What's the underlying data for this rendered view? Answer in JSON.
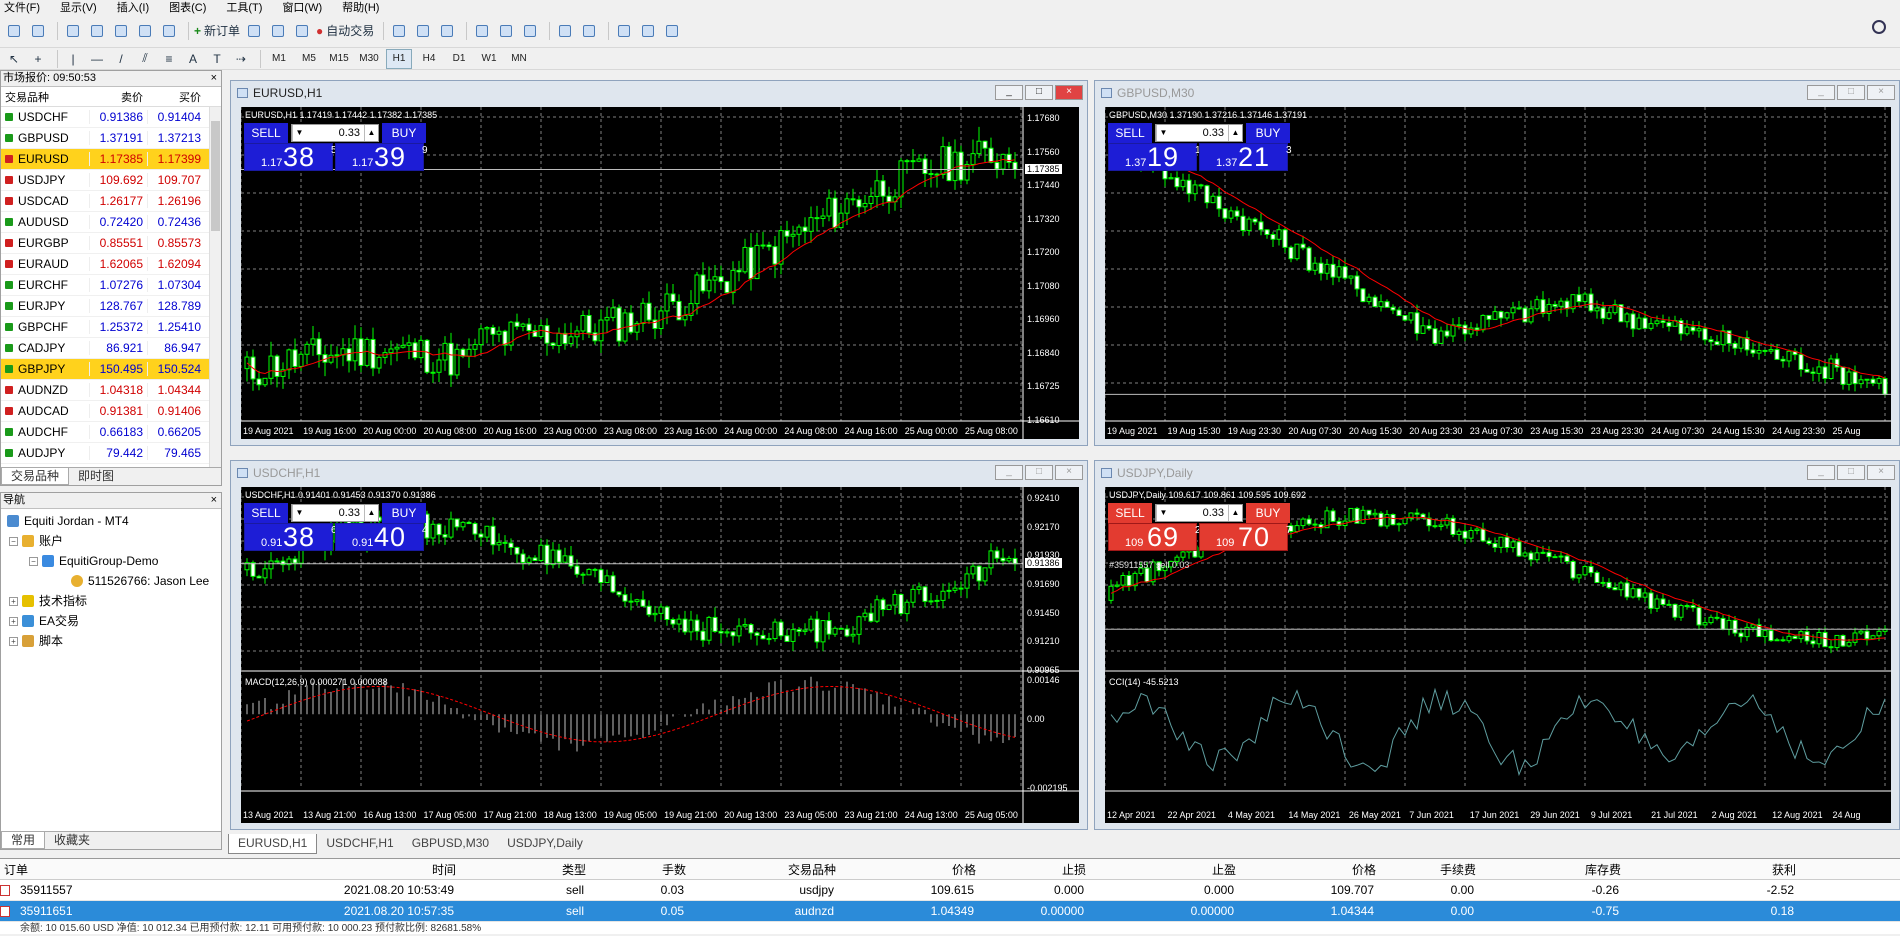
{
  "menu": [
    "文件(F)",
    "显示(V)",
    "插入(I)",
    "图表(C)",
    "工具(T)",
    "窗口(W)",
    "帮助(H)"
  ],
  "toolbar": {
    "new_order": "新订单",
    "auto_trade": "自动交易"
  },
  "timeframes": [
    "M1",
    "M5",
    "M15",
    "M30",
    "H1",
    "H4",
    "D1",
    "W1",
    "MN"
  ],
  "active_timeframe": "H1",
  "market_watch": {
    "title": "市场报价: 09:50:53",
    "headers": [
      "交易品种",
      "卖价",
      "买价"
    ],
    "rows": [
      {
        "sym": "USDCHF",
        "bid": "0.91386",
        "ask": "0.91404",
        "dir": "up",
        "hl": false
      },
      {
        "sym": "GBPUSD",
        "bid": "1.37191",
        "ask": "1.37213",
        "dir": "up",
        "hl": false
      },
      {
        "sym": "EURUSD",
        "bid": "1.17385",
        "ask": "1.17399",
        "dir": "dn",
        "hl": true
      },
      {
        "sym": "USDJPY",
        "bid": "109.692",
        "ask": "109.707",
        "dir": "dn",
        "hl": false
      },
      {
        "sym": "USDCAD",
        "bid": "1.26177",
        "ask": "1.26196",
        "dir": "dn",
        "hl": false
      },
      {
        "sym": "AUDUSD",
        "bid": "0.72420",
        "ask": "0.72436",
        "dir": "up",
        "hl": false
      },
      {
        "sym": "EURGBP",
        "bid": "0.85551",
        "ask": "0.85573",
        "dir": "dn",
        "hl": false
      },
      {
        "sym": "EURAUD",
        "bid": "1.62065",
        "ask": "1.62094",
        "dir": "dn",
        "hl": false
      },
      {
        "sym": "EURCHF",
        "bid": "1.07276",
        "ask": "1.07304",
        "dir": "up",
        "hl": false
      },
      {
        "sym": "EURJPY",
        "bid": "128.767",
        "ask": "128.789",
        "dir": "up",
        "hl": false
      },
      {
        "sym": "GBPCHF",
        "bid": "1.25372",
        "ask": "1.25410",
        "dir": "up",
        "hl": false
      },
      {
        "sym": "CADJPY",
        "bid": "86.921",
        "ask": "86.947",
        "dir": "up",
        "hl": false
      },
      {
        "sym": "GBPJPY",
        "bid": "150.495",
        "ask": "150.524",
        "dir": "up",
        "hl": true
      },
      {
        "sym": "AUDNZD",
        "bid": "1.04318",
        "ask": "1.04344",
        "dir": "dn",
        "hl": false
      },
      {
        "sym": "AUDCAD",
        "bid": "0.91381",
        "ask": "0.91406",
        "dir": "dn",
        "hl": false
      },
      {
        "sym": "AUDCHF",
        "bid": "0.66183",
        "ask": "0.66205",
        "dir": "up",
        "hl": false
      },
      {
        "sym": "AUDJPY",
        "bid": "79.442",
        "ask": "79.465",
        "dir": "up",
        "hl": false
      }
    ],
    "tabs": [
      "交易品种",
      "即时图"
    ]
  },
  "navigator": {
    "title": "导航",
    "items": [
      "Equiti Jordan - MT4",
      "账户",
      "EquitiGroup-Demo",
      "511526766: Jason Lee",
      "技术指标",
      "EA交易",
      "脚本"
    ],
    "tabs": [
      "常用",
      "收藏夹"
    ]
  },
  "charts": [
    {
      "title": "EURUSD,H1",
      "ohlc": "EURUSD,H1  1.17419 1.17442 1.17382 1.17385",
      "active": true,
      "trade": {
        "sell": "SELL",
        "buy": "BUY",
        "vol": "0.33",
        "sell_small": "1.17",
        "sell_big": "38",
        "sell_sup": "5",
        "buy_small": "1.17",
        "buy_big": "39",
        "buy_sup": "9",
        "theme": "blue"
      },
      "yticks": [
        "1.17680",
        "1.17560",
        "1.17440",
        "1.17320",
        "1.17200",
        "1.17080",
        "1.16960",
        "1.16840",
        "1.16725",
        "1.16610"
      ],
      "price_tag": "1.17385",
      "xticks": [
        "19 Aug 2021",
        "19 Aug 16:00",
        "20 Aug 00:00",
        "20 Aug 08:00",
        "20 Aug 16:00",
        "23 Aug 00:00",
        "23 Aug 08:00",
        "23 Aug 16:00",
        "24 Aug 00:00",
        "24 Aug 08:00",
        "24 Aug 16:00",
        "25 Aug 00:00",
        "25 Aug 08:00"
      ]
    },
    {
      "title": "GBPUSD,M30",
      "ohlc": "GBPUSD,M30  1.37190 1.37216 1.37146 1.37191",
      "active": false,
      "trade": {
        "sell": "SELL",
        "buy": "BUY",
        "vol": "0.33",
        "sell_small": "1.37",
        "sell_big": "19",
        "sell_sup": "1",
        "buy_small": "1.37",
        "buy_big": "21",
        "buy_sup": "3",
        "theme": "blue"
      },
      "yticks": [],
      "price_tag": "",
      "xticks": [
        "19 Aug 2021",
        "19 Aug 15:30",
        "19 Aug 23:30",
        "20 Aug 07:30",
        "20 Aug 15:30",
        "20 Aug 23:30",
        "23 Aug 07:30",
        "23 Aug 15:30",
        "23 Aug 23:30",
        "24 Aug 07:30",
        "24 Aug 15:30",
        "24 Aug 23:30",
        "25 Aug"
      ]
    },
    {
      "title": "USDCHF,H1",
      "ohlc": "USDCHF,H1  0.91401 0.91453 0.91370 0.91386",
      "active": false,
      "trade": {
        "sell": "SELL",
        "buy": "BUY",
        "vol": "0.33",
        "sell_small": "0.91",
        "sell_big": "38",
        "sell_sup": "6",
        "buy_small": "0.91",
        "buy_big": "40",
        "buy_sup": "4",
        "theme": "blue"
      },
      "yticks": [
        "0.92410",
        "0.92170",
        "0.91930",
        "0.91690",
        "0.91450",
        "0.91210",
        "0.90965"
      ],
      "price_tag": "0.91386",
      "sub_title": "MACD(12,26,9) 0.000271 0.000088",
      "sub_yticks": [
        "0.00146",
        "0.00",
        "-0.002195"
      ],
      "xticks": [
        "13 Aug 2021",
        "13 Aug 21:00",
        "16 Aug 13:00",
        "17 Aug 05:00",
        "17 Aug 21:00",
        "18 Aug 13:00",
        "19 Aug 05:00",
        "19 Aug 21:00",
        "20 Aug 13:00",
        "23 Aug 05:00",
        "23 Aug 21:00",
        "24 Aug 13:00",
        "25 Aug 05:00"
      ]
    },
    {
      "title": "USDJPY,Daily",
      "ohlc": "USDJPY,Daily  109.617 109.861 109.595 109.692",
      "active": false,
      "trade": {
        "sell": "SELL",
        "buy": "BUY",
        "vol": "0.33",
        "sell_small": "109",
        "sell_big": "69",
        "sell_sup": "2",
        "buy_small": "109",
        "buy_big": "70",
        "buy_sup": "7",
        "theme": "red"
      },
      "annot": "#35911557 sell 0.03",
      "sub_title": "CCI(14) -45.5213",
      "xticks": [
        "12 Apr 2021",
        "22 Apr 2021",
        "4 May 2021",
        "14 May 2021",
        "26 May 2021",
        "7 Jun 2021",
        "17 Jun 2021",
        "29 Jun 2021",
        "9 Jul 2021",
        "21 Jul 2021",
        "2 Aug 2021",
        "12 Aug 2021",
        "24 Aug"
      ]
    }
  ],
  "chart_tabs": [
    "EURUSD,H1",
    "USDCHF,H1",
    "GBPUSD,M30",
    "USDJPY,Daily"
  ],
  "orders": {
    "headers": [
      "订单",
      "时间",
      "类型",
      "手数",
      "交易品种",
      "价格",
      "止损",
      "止盈",
      "价格",
      "手续费",
      "库存费",
      "获利"
    ],
    "rows": [
      {
        "id": "35911557",
        "time": "2021.08.20 10:53:49",
        "type": "sell",
        "lots": "0.03",
        "sym": "usdjpy",
        "price": "109.615",
        "sl": "0.000",
        "tp": "0.000",
        "cur": "109.707",
        "comm": "0.00",
        "swap": "-0.26",
        "profit": "-2.52",
        "sel": false
      },
      {
        "id": "35911651",
        "time": "2021.08.20 10:57:35",
        "type": "sell",
        "lots": "0.05",
        "sym": "audnzd",
        "price": "1.04349",
        "sl": "0.00000",
        "tp": "0.00000",
        "cur": "1.04344",
        "comm": "0.00",
        "swap": "-0.75",
        "profit": "0.18",
        "sel": true
      }
    ],
    "status": "余额: 10 015.60 USD  净值: 10 012.34  已用预付款: 12.11  可用预付款: 10 000.23  预付款比例: 82681.58%"
  },
  "colors": {
    "candle": "#00ff00",
    "ma": "#ff0000",
    "grid": "#808080",
    "macd": "#c0c0c0",
    "cci": "#5f9ea0"
  }
}
